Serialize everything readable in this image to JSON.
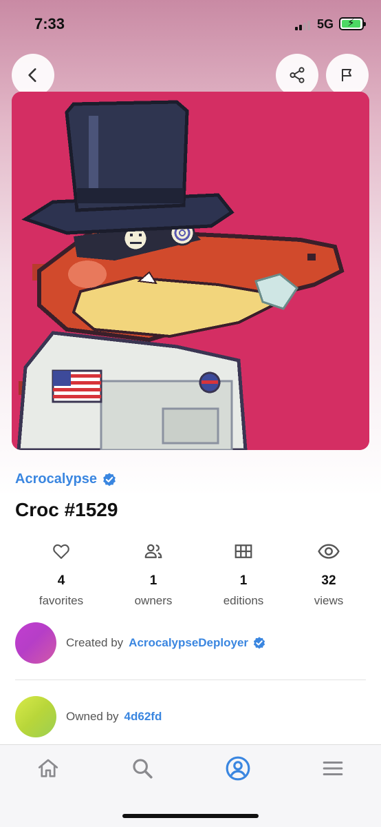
{
  "status_bar": {
    "time": "7:33",
    "network": "5G",
    "icons": [
      "signal-icon",
      "battery-charging-icon"
    ]
  },
  "header": {
    "back_icon": "chevron-left-icon",
    "share_icon": "share-icon",
    "report_icon": "flag-icon"
  },
  "nft": {
    "image_icon": "pixel-art-crocodile-astronaut",
    "collection": "Acrocalypse",
    "collection_verified": true,
    "title": "Croc #1529"
  },
  "stats": [
    {
      "icon": "heart-icon",
      "value": "4",
      "label": "favorites"
    },
    {
      "icon": "users-icon",
      "value": "1",
      "label": "owners"
    },
    {
      "icon": "grid-icon",
      "value": "1",
      "label": "editions"
    },
    {
      "icon": "eye-icon",
      "value": "32",
      "label": "views"
    }
  ],
  "creator": {
    "prefix": "Created by",
    "name": "AcrocalypseDeployer",
    "verified": true
  },
  "owner": {
    "prefix": "Owned by",
    "name": "4d62fd"
  },
  "tab_bar": {
    "tabs": [
      {
        "icon": "home-icon",
        "active": false
      },
      {
        "icon": "search-icon",
        "active": false
      },
      {
        "icon": "profile-icon",
        "active": true
      },
      {
        "icon": "menu-icon",
        "active": false
      }
    ]
  },
  "colors": {
    "accent": "#3a86e0",
    "image_background": "#d42e63"
  }
}
